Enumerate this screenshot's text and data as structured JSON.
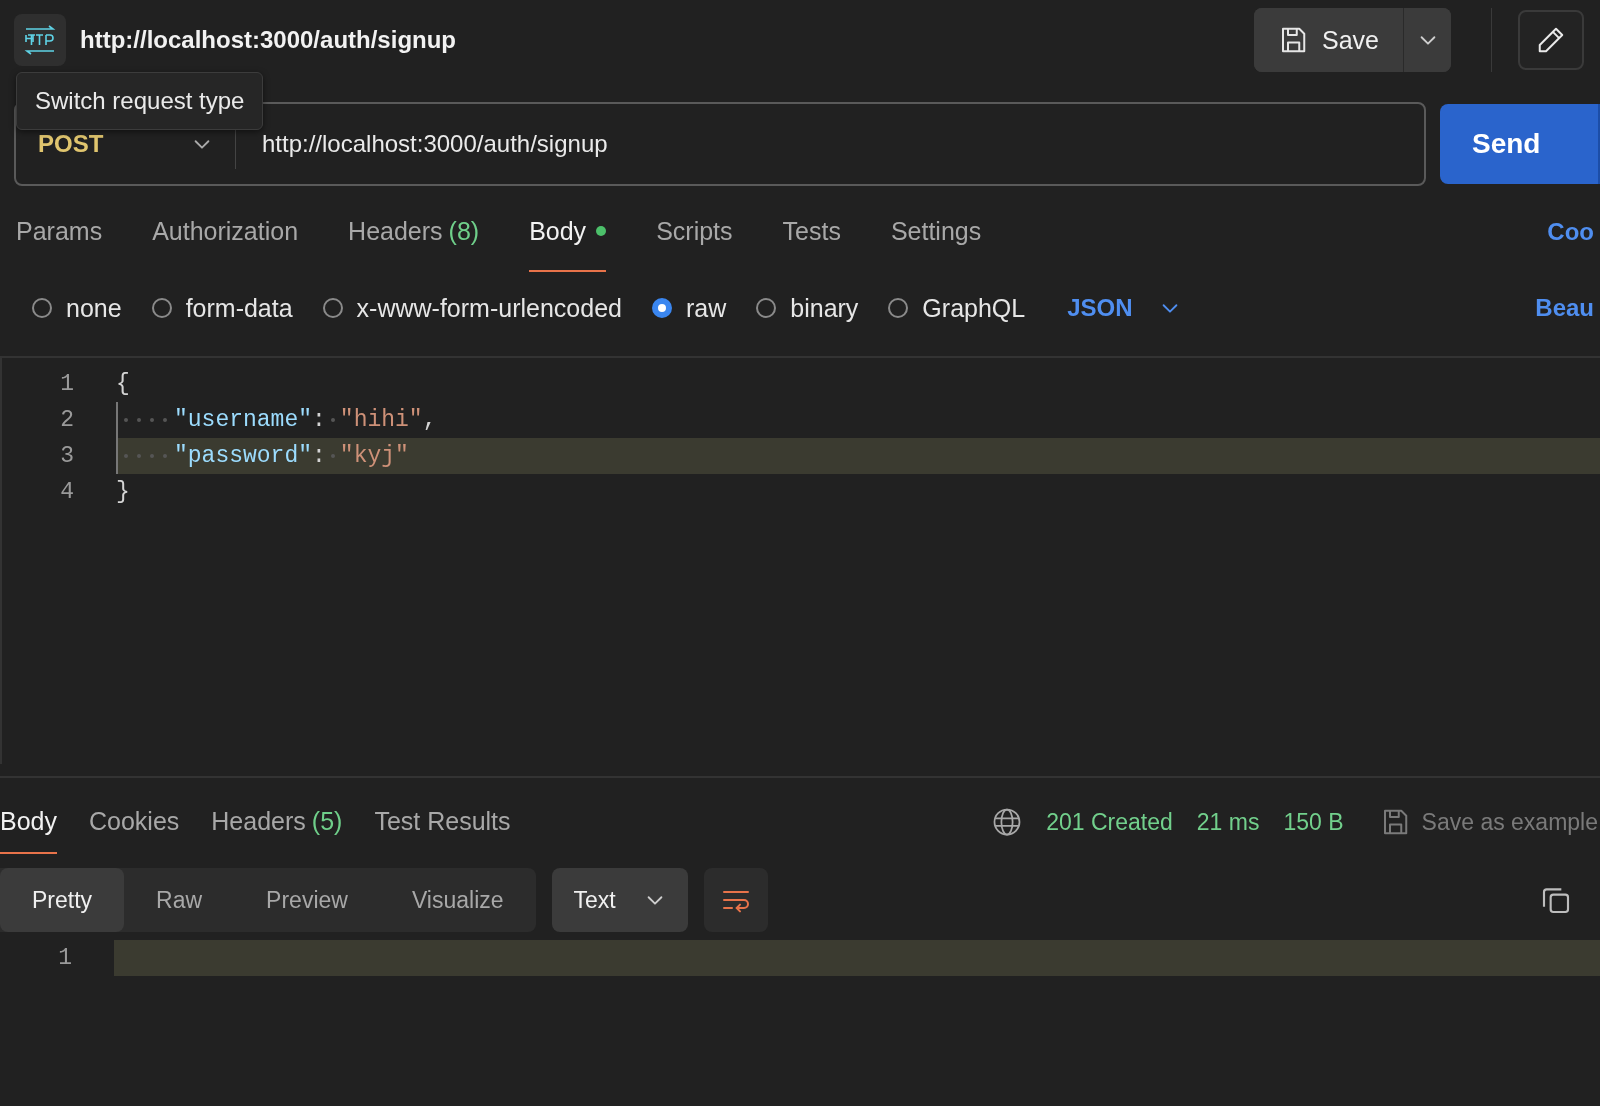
{
  "header": {
    "title": "http://localhost:3000/auth/signup",
    "save": "Save"
  },
  "tooltip": "Switch request type",
  "request": {
    "method": "POST",
    "url": "http://localhost:3000/auth/signup",
    "send": "Send"
  },
  "request_tabs": [
    {
      "label": "Params",
      "selected": false
    },
    {
      "label": "Authorization",
      "selected": false
    },
    {
      "label": "Headers",
      "count": "(8)",
      "selected": false
    },
    {
      "label": "Body",
      "selected": true,
      "modified": true
    },
    {
      "label": "Scripts",
      "selected": false
    },
    {
      "label": "Tests",
      "selected": false
    },
    {
      "label": "Settings",
      "selected": false
    }
  ],
  "cookies_link": "Coo",
  "body_types": [
    {
      "label": "none",
      "selected": false
    },
    {
      "label": "form-data",
      "selected": false
    },
    {
      "label": "x-www-form-urlencoded",
      "selected": false
    },
    {
      "label": "raw",
      "selected": true
    },
    {
      "label": "binary",
      "selected": false
    },
    {
      "label": "GraphQL",
      "selected": false
    }
  ],
  "body_format": "JSON",
  "beautify_link": "Beau",
  "editor": {
    "lines": [
      {
        "number": "1",
        "indent": false,
        "highlighted": false,
        "tokens": [
          {
            "kind": "punct",
            "text": "{"
          }
        ]
      },
      {
        "number": "2",
        "indent": true,
        "highlighted": false,
        "tokens": [
          {
            "kind": "key",
            "text": "\"username\""
          },
          {
            "kind": "punct",
            "text": ":"
          },
          {
            "kind": "space"
          },
          {
            "kind": "string",
            "text": "\"hihi\""
          },
          {
            "kind": "punct",
            "text": ","
          }
        ]
      },
      {
        "number": "3",
        "indent": true,
        "highlighted": true,
        "tokens": [
          {
            "kind": "key",
            "text": "\"password\""
          },
          {
            "kind": "punct",
            "text": ":"
          },
          {
            "kind": "space"
          },
          {
            "kind": "string",
            "text": "\"kyj\""
          }
        ]
      },
      {
        "number": "4",
        "indent": false,
        "highlighted": false,
        "tokens": [
          {
            "kind": "punct",
            "text": "}"
          }
        ]
      }
    ]
  },
  "response": {
    "tabs": [
      {
        "label": "Body",
        "selected": true
      },
      {
        "label": "Cookies",
        "selected": false
      },
      {
        "label": "Headers",
        "count": "(5)",
        "selected": false
      },
      {
        "label": "Test Results",
        "selected": false
      }
    ],
    "status": "201 Created",
    "time": "21 ms",
    "size": "150 B",
    "save_example": "Save as example",
    "view_modes": [
      {
        "label": "Pretty",
        "selected": true
      },
      {
        "label": "Raw",
        "selected": false
      },
      {
        "label": "Preview",
        "selected": false
      },
      {
        "label": "Visualize",
        "selected": false
      }
    ],
    "format": "Text",
    "lines": [
      {
        "number": "1",
        "highlighted": true
      }
    ]
  }
}
